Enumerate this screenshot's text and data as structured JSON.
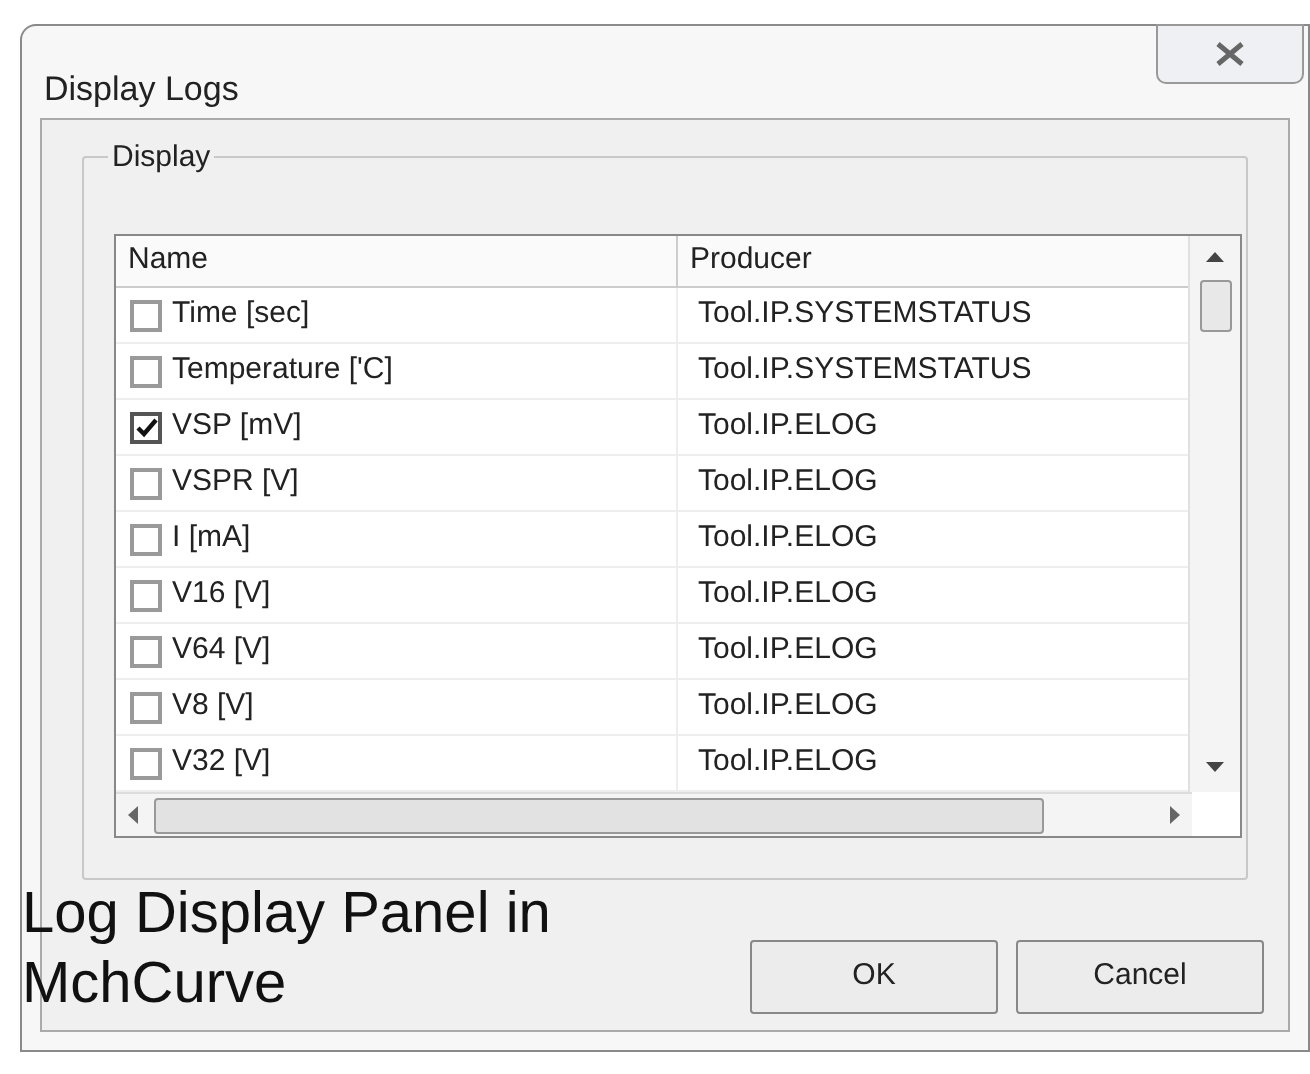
{
  "window": {
    "title": "Display Logs"
  },
  "group": {
    "title": "Display"
  },
  "table": {
    "columns": [
      "Name",
      "Producer"
    ],
    "rows": [
      {
        "name": "Time [sec]",
        "producer": "Tool.IP.SYSTEMSTATUS",
        "checked": false
      },
      {
        "name": "Temperature ['C]",
        "producer": "Tool.IP.SYSTEMSTATUS",
        "checked": false
      },
      {
        "name": "VSP [mV]",
        "producer": "Tool.IP.ELOG",
        "checked": true
      },
      {
        "name": "VSPR [V]",
        "producer": "Tool.IP.ELOG",
        "checked": false
      },
      {
        "name": "I [mA]",
        "producer": "Tool.IP.ELOG",
        "checked": false
      },
      {
        "name": "V16 [V]",
        "producer": "Tool.IP.ELOG",
        "checked": false
      },
      {
        "name": "V64 [V]",
        "producer": "Tool.IP.ELOG",
        "checked": false
      },
      {
        "name": "V8 [V]",
        "producer": "Tool.IP.ELOG",
        "checked": false
      },
      {
        "name": "V32 [V]",
        "producer": "Tool.IP.ELOG",
        "checked": false
      }
    ]
  },
  "caption": [
    "Log Display Panel in",
    "MchCurve"
  ],
  "buttons": [
    "OK",
    "Cancel"
  ]
}
